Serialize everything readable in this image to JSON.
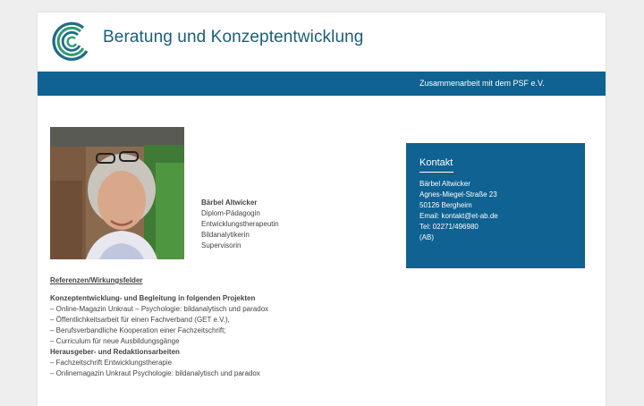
{
  "header": {
    "site_title": "Beratung und Konzeptentwicklung"
  },
  "nav": {
    "link_label": "Zusammenarbeit mit dem PSF e.V."
  },
  "bio": {
    "name": "Bärbel Altwicker",
    "roles": [
      "Diplom-Pädagogin",
      "Entwicklungstherapeutin",
      "Bildanalytikerin",
      "Supervisorin"
    ]
  },
  "contact": {
    "title": "Kontakt",
    "lines": [
      "Bärbel Altwicker",
      "Agnes-Miegel-Straße 23",
      "50126 Bergheim",
      "Email: kontakt@et-ab.de",
      "Tel: 02271/496980",
      "(AB)"
    ]
  },
  "references": {
    "heading": "Referenzen/Wirkungsfelder",
    "section1_title": "Konzeptentwicklung- und Begleitung in folgenden Projekten",
    "section1_items": [
      "– Online-Magazin Unkraut – Psychologie: bildanalytisch und paradox",
      "– Öffentlichkeitsarbeit für einen Fachverband (GET e.V.),",
      "– Berufsverbandliche Kooperation einer Fachzeitschrift;",
      "– Curriculum für neue Ausbildungsgänge"
    ],
    "section2_title": "Herausgeber- und Redaktionsarbeiten",
    "section2_items": [
      "– Fachzeitschrift Entwicklungstherapie",
      "– Onlinemagazin Unkraut Psychologie: bildanalytisch und paradox"
    ]
  },
  "colors": {
    "brand_blue": "#0f6291",
    "title_blue": "#1a5f7a",
    "logo_green": "#2e9b6f"
  },
  "icons": {
    "logo": "concentric-arcs-logo"
  }
}
